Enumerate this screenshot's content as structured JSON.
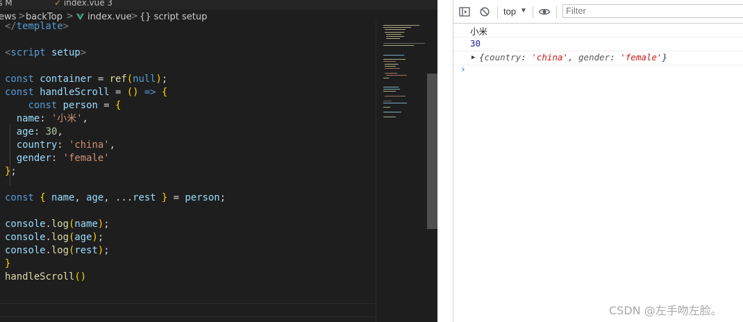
{
  "editor": {
    "tabs": [
      {
        "label": "js M"
      },
      {
        "label": "index.vue 3"
      }
    ],
    "breadcrumb": {
      "items": [
        "ews",
        "backTop",
        "index.vue",
        "{} script setup"
      ],
      "separator": ">"
    },
    "code_lines": [
      "</template>",
      "",
      "<script setup>",
      "",
      "const container = ref(null);",
      "const handleScroll = () => {",
      "    const person = {",
      "  name: '小米',",
      "  age: 30,",
      "  country: 'china',",
      "  gender: 'female'",
      "};",
      "",
      "const { name, age, ...rest } = person;",
      "",
      "console.log(name);",
      "console.log(age);",
      "console.log(rest);",
      "}",
      "handleScroll()"
    ]
  },
  "devtools": {
    "toolbar": {
      "context": "top",
      "filter_placeholder": "Filter",
      "icons": [
        "sidebar-toggle-icon",
        "clear-console-icon",
        "eye-icon"
      ]
    },
    "console": {
      "entries": [
        {
          "text": "小米",
          "kind": "string"
        },
        {
          "text": "30",
          "kind": "number"
        },
        {
          "prefix": "{",
          "key1": "country",
          "val1": "'china'",
          "sep": ", ",
          "key2": "gender",
          "val2": "'female'",
          "suffix": "}",
          "kind": "object"
        }
      ],
      "prompt": "›"
    },
    "watermark": "CSDN @左手吻左脸。"
  },
  "colors": {
    "editor_bg": "#1e1e1e",
    "keyword": "#569cd6",
    "variable": "#9cdcfe",
    "function": "#dcdcaa",
    "string": "#ce9178",
    "number": "#b5cea8",
    "console_number": "#1a1aa6",
    "console_string": "#c41a16",
    "prompt": "#1a73e8"
  }
}
